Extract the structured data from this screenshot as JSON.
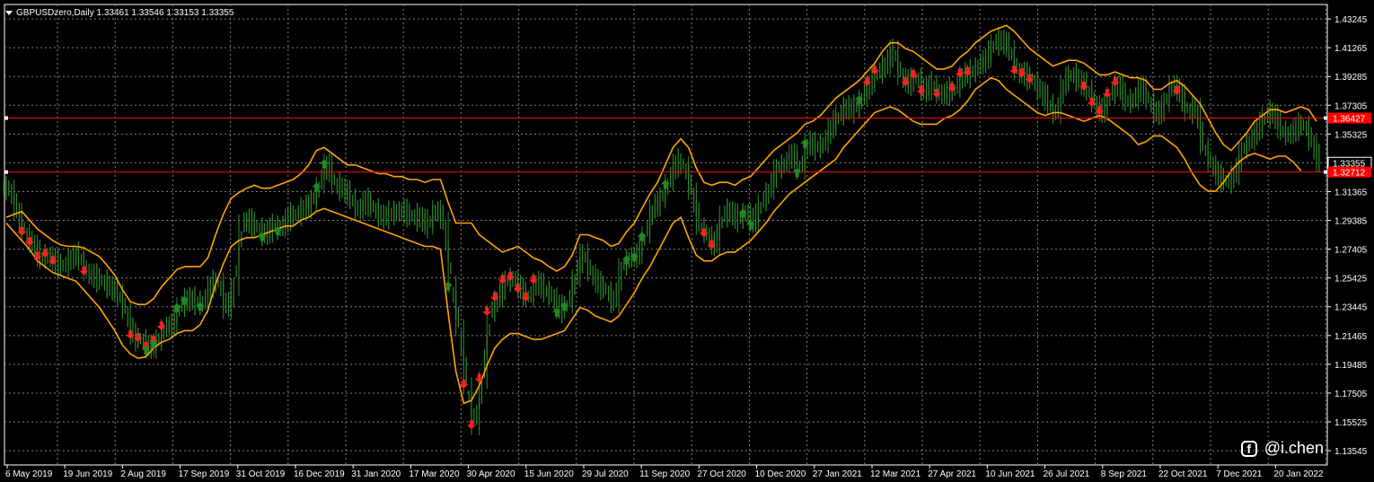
{
  "header": {
    "symbol": "GBPUSDzero,Daily",
    "ohlc": "1.33461 1.33546 1.33153 1.33355"
  },
  "watermark": {
    "text": "@i.chen",
    "icon": "facebook-icon"
  },
  "colors": {
    "background": "#000000",
    "grid": "#7f7f7f",
    "candles": "#2e8b2e",
    "bands": "#ffa500",
    "levels": "#ff0000",
    "buy_arrows": "#228b22",
    "sell_arrows": "#ff2020",
    "text": "#ffffff"
  },
  "chart_data": {
    "type": "line",
    "title": "GBPUSDzero,Daily",
    "y_axis_ticks": [
      "1.43245",
      "1.41265",
      "1.39285",
      "1.37305",
      "1.35325",
      "1.33345",
      "1.31365",
      "1.29385",
      "1.27405",
      "1.25425",
      "1.23445",
      "1.21465",
      "1.19485",
      "1.17505",
      "1.15525",
      "1.13545"
    ],
    "ylim": [
      1.13545,
      1.43245
    ],
    "x_axis_ticks": [
      "6 May 2019",
      "19 Jun 2019",
      "2 Aug 2019",
      "17 Sep 2019",
      "31 Oct 2019",
      "16 Dec 2019",
      "31 Jan 2020",
      "17 Mar 2020",
      "30 Apr 2020",
      "15 Jun 2020",
      "29 Jul 2020",
      "11 Sep 2020",
      "27 Oct 2020",
      "10 Dec 2020",
      "27 Jan 2021",
      "12 Mar 2021",
      "27 Apr 2021",
      "10 Jun 2021",
      "26 Jul 2021",
      "8 Sep 2021",
      "22 Oct 2021",
      "7 Dec 2021",
      "20 Jan 2022"
    ],
    "price_labels": [
      {
        "value": "1.36427",
        "y": 1.36427,
        "color": "#ff0000"
      },
      {
        "value": "1.33355",
        "y": 1.33355,
        "color": "#ffffff"
      },
      {
        "value": "1.32712",
        "y": 1.32712,
        "color": "#ff0000"
      }
    ],
    "horizontal_levels": [
      1.36427,
      1.32712
    ],
    "grid": true,
    "series": [
      {
        "kind": "close",
        "values": [
          1.316,
          1.3,
          1.285,
          1.278,
          1.268,
          1.27,
          1.265,
          1.262,
          1.268,
          1.27,
          1.258,
          1.255,
          1.252,
          1.248,
          1.244,
          1.232,
          1.214,
          1.212,
          1.206,
          1.21,
          1.22,
          1.222,
          1.235,
          1.24,
          1.238,
          1.236,
          1.25,
          1.252,
          1.232,
          1.248,
          1.292,
          1.294,
          1.288,
          1.284,
          1.29,
          1.288,
          1.296,
          1.298,
          1.302,
          1.306,
          1.318,
          1.334,
          1.318,
          1.316,
          1.31,
          1.3,
          1.308,
          1.302,
          1.296,
          1.298,
          1.3,
          1.3,
          1.296,
          1.296,
          1.29,
          1.302,
          1.294,
          1.25,
          1.22,
          1.18,
          1.152,
          1.184,
          1.23,
          1.24,
          1.252,
          1.254,
          1.246,
          1.24,
          1.252,
          1.246,
          1.242,
          1.232,
          1.236,
          1.254,
          1.272,
          1.258,
          1.25,
          1.246,
          1.236,
          1.262,
          1.268,
          1.27,
          1.284,
          1.302,
          1.308,
          1.32,
          1.334,
          1.332,
          1.314,
          1.29,
          1.284,
          1.276,
          1.298,
          1.3,
          1.294,
          1.3,
          1.292,
          1.306,
          1.314,
          1.33,
          1.332,
          1.34,
          1.328,
          1.348,
          1.344,
          1.346,
          1.358,
          1.366,
          1.372,
          1.37,
          1.378,
          1.388,
          1.396,
          1.4,
          1.412,
          1.393,
          1.388,
          1.393,
          1.382,
          1.388,
          1.38,
          1.382,
          1.384,
          1.394,
          1.395,
          1.4,
          1.405,
          1.416,
          1.418,
          1.412,
          1.396,
          1.394,
          1.39,
          1.383,
          1.375,
          1.366,
          1.388,
          1.395,
          1.39,
          1.385,
          1.374,
          1.368,
          1.38,
          1.388,
          1.376,
          1.376,
          1.386,
          1.376,
          1.366,
          1.374,
          1.388,
          1.382,
          1.368,
          1.372,
          1.345,
          1.333,
          1.324,
          1.32,
          1.324,
          1.342,
          1.348,
          1.356,
          1.366,
          1.368,
          1.356,
          1.352,
          1.358,
          1.36,
          1.348,
          1.333
        ],
        "color": "#2e8b2e"
      },
      {
        "kind": "upper-band",
        "values": [
          1.296,
          1.298,
          1.3,
          1.294,
          1.288,
          1.284,
          1.28,
          1.277,
          1.276,
          1.276,
          1.275,
          1.272,
          1.269,
          1.263,
          1.256,
          1.246,
          1.238,
          1.236,
          1.236,
          1.24,
          1.248,
          1.254,
          1.26,
          1.262,
          1.262,
          1.262,
          1.268,
          1.284,
          1.298,
          1.309,
          1.313,
          1.316,
          1.318,
          1.316,
          1.316,
          1.318,
          1.32,
          1.322,
          1.326,
          1.332,
          1.342,
          1.344,
          1.34,
          1.336,
          1.332,
          1.332,
          1.33,
          1.328,
          1.326,
          1.326,
          1.324,
          1.324,
          1.322,
          1.322,
          1.32,
          1.322,
          1.322,
          1.306,
          1.292,
          1.292,
          1.292,
          1.284,
          1.28,
          1.276,
          1.272,
          1.274,
          1.276,
          1.272,
          1.268,
          1.266,
          1.262,
          1.259,
          1.262,
          1.27,
          1.284,
          1.284,
          1.282,
          1.28,
          1.276,
          1.278,
          1.286,
          1.292,
          1.302,
          1.312,
          1.32,
          1.332,
          1.344,
          1.35,
          1.344,
          1.33,
          1.32,
          1.318,
          1.32,
          1.32,
          1.318,
          1.322,
          1.324,
          1.33,
          1.336,
          1.342,
          1.346,
          1.35,
          1.354,
          1.36,
          1.362,
          1.366,
          1.372,
          1.378,
          1.382,
          1.386,
          1.39,
          1.396,
          1.402,
          1.41,
          1.416,
          1.416,
          1.412,
          1.41,
          1.406,
          1.402,
          1.398,
          1.398,
          1.4,
          1.406,
          1.41,
          1.416,
          1.42,
          1.424,
          1.426,
          1.428,
          1.424,
          1.418,
          1.412,
          1.408,
          1.404,
          1.4,
          1.402,
          1.404,
          1.404,
          1.402,
          1.398,
          1.394,
          1.394,
          1.396,
          1.394,
          1.392,
          1.392,
          1.39,
          1.384,
          1.384,
          1.388,
          1.39,
          1.386,
          1.38,
          1.374,
          1.364,
          1.354,
          1.346,
          1.342,
          1.348,
          1.354,
          1.362,
          1.366,
          1.37,
          1.37,
          1.368,
          1.37,
          1.372,
          1.37,
          1.362
        ],
        "color": "#ffa500"
      },
      {
        "kind": "lower-band",
        "values": [
          1.292,
          1.286,
          1.28,
          1.274,
          1.266,
          1.262,
          1.258,
          1.256,
          1.254,
          1.252,
          1.246,
          1.24,
          1.234,
          1.226,
          1.218,
          1.208,
          1.202,
          1.199,
          1.2,
          1.206,
          1.21,
          1.212,
          1.216,
          1.218,
          1.218,
          1.222,
          1.232,
          1.25,
          1.264,
          1.276,
          1.28,
          1.282,
          1.282,
          1.284,
          1.286,
          1.288,
          1.29,
          1.29,
          1.294,
          1.296,
          1.3,
          1.302,
          1.3,
          1.298,
          1.296,
          1.294,
          1.292,
          1.29,
          1.288,
          1.286,
          1.284,
          1.282,
          1.28,
          1.278,
          1.276,
          1.276,
          1.274,
          1.23,
          1.19,
          1.168,
          1.17,
          1.18,
          1.194,
          1.206,
          1.212,
          1.216,
          1.216,
          1.214,
          1.212,
          1.212,
          1.214,
          1.216,
          1.218,
          1.226,
          1.234,
          1.232,
          1.228,
          1.226,
          1.224,
          1.228,
          1.236,
          1.244,
          1.254,
          1.262,
          1.272,
          1.282,
          1.292,
          1.296,
          1.282,
          1.27,
          1.266,
          1.266,
          1.27,
          1.272,
          1.272,
          1.276,
          1.28,
          1.286,
          1.292,
          1.3,
          1.306,
          1.312,
          1.316,
          1.32,
          1.324,
          1.328,
          1.332,
          1.336,
          1.344,
          1.35,
          1.356,
          1.362,
          1.368,
          1.37,
          1.372,
          1.37,
          1.366,
          1.362,
          1.36,
          1.36,
          1.36,
          1.364,
          1.366,
          1.37,
          1.376,
          1.384,
          1.388,
          1.392,
          1.39,
          1.384,
          1.38,
          1.376,
          1.372,
          1.368,
          1.366,
          1.368,
          1.368,
          1.366,
          1.364,
          1.362,
          1.364,
          1.366,
          1.364,
          1.36,
          1.356,
          1.352,
          1.346,
          1.348,
          1.352,
          1.352,
          1.348,
          1.344,
          1.336,
          1.326,
          1.318,
          1.314,
          1.314,
          1.32,
          1.328,
          1.334,
          1.338,
          1.34,
          1.338,
          1.336,
          1.338,
          1.338,
          1.334,
          1.328
        ],
        "color": "#ffa500"
      }
    ],
    "sell_signals_idx": [
      2,
      3,
      4,
      5,
      6,
      10,
      16,
      17,
      18,
      19,
      20,
      59,
      60,
      61,
      62,
      63,
      64,
      65,
      66,
      67,
      68,
      90,
      91,
      111,
      112,
      116,
      117,
      118,
      120,
      122,
      123,
      124,
      130,
      131,
      132,
      139,
      140,
      141,
      142,
      143,
      151
    ],
    "buy_signals_idx": [
      18,
      19,
      22,
      23,
      25,
      33,
      35,
      40,
      41,
      57,
      71,
      72,
      80,
      81,
      82,
      85,
      95,
      96,
      102,
      103,
      110
    ]
  }
}
